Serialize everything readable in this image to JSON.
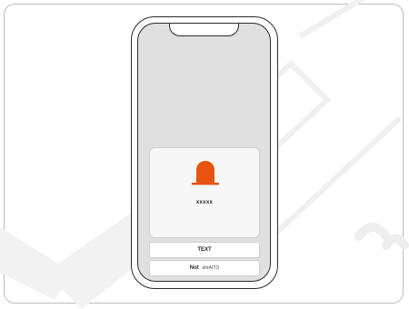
{
  "alert": {
    "label": "xxxxx",
    "icon": "bell-icon",
    "icon_color": "#e8540f"
  },
  "actions": {
    "text_label": "TEXT",
    "not_label": "Not",
    "not_sub": "ahrAITO"
  }
}
